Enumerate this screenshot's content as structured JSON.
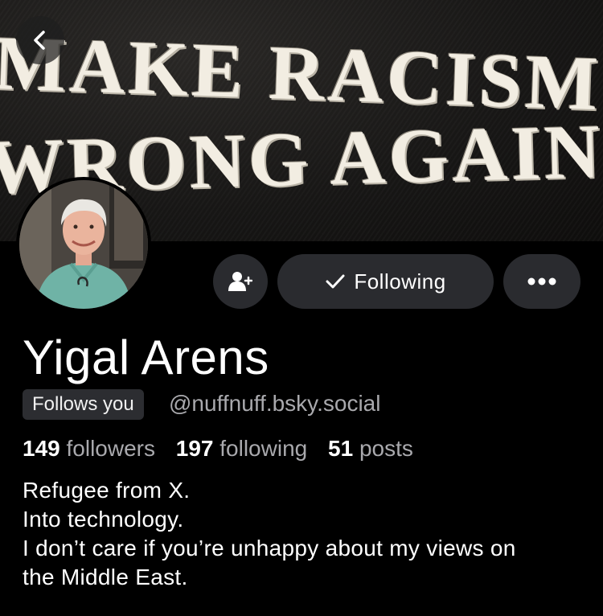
{
  "banner": {
    "line1": "MAKE RACISM",
    "line2": "WRONG AGAIN"
  },
  "nav": {
    "back_icon": "chevron-left-icon"
  },
  "actions": {
    "add_icon": "person-add-icon",
    "following_label": "Following",
    "following_icon": "checkmark-icon",
    "more_icon": "ellipsis-icon"
  },
  "profile": {
    "display_name": "Yigal Arens",
    "follows_you": "Follows you",
    "handle": "@nuffnuff.bsky.social"
  },
  "stats": {
    "followers_count": "149",
    "followers_label": "followers",
    "following_count": "197",
    "following_label": "following",
    "posts_count": "51",
    "posts_label": "posts"
  },
  "bio": {
    "lines": [
      "Refugee from X.",
      "Into technology.",
      "I don’t care if you’re unhappy about my views on",
      "the Middle East."
    ]
  },
  "colors": {
    "background": "#000000",
    "button_bg": "#2a2b2f",
    "muted_text": "#a9a9ad",
    "badge_bg": "#2c2d31"
  }
}
